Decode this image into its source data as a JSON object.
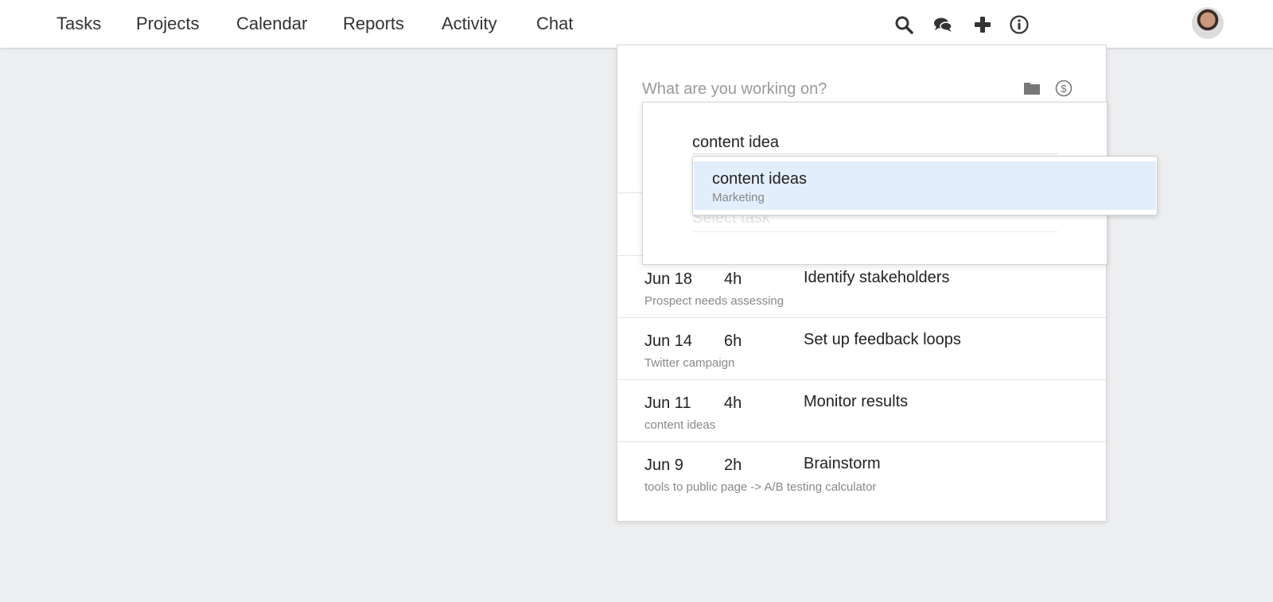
{
  "nav": {
    "items": [
      "Tasks",
      "Projects",
      "Calendar",
      "Reports",
      "Activity",
      "Chat"
    ],
    "icons": [
      "search-icon",
      "chat-icon",
      "plus-icon",
      "info-icon"
    ]
  },
  "timer": {
    "placeholder": "What are you working on?",
    "icons": [
      "folder-icon",
      "dollar-icon"
    ]
  },
  "project_picker": {
    "query": "content idea",
    "task_placeholder": "Select task",
    "option": {
      "name": "content ideas",
      "client": "Marketing"
    }
  },
  "entries": [
    {
      "date": "Jun 18",
      "hours": "4h",
      "title": "Identify stakeholders",
      "project": "Prospect needs assessing"
    },
    {
      "date": "Jun 14",
      "hours": "6h",
      "title": "Set up feedback loops",
      "project": "Twitter campaign"
    },
    {
      "date": "Jun 11",
      "hours": "4h",
      "title": "Monitor results",
      "project": "content ideas"
    },
    {
      "date": "Jun 9",
      "hours": "2h",
      "title": "Brainstorm",
      "project": "tools to public page -> A/B testing calculator"
    }
  ],
  "colors": {
    "highlight": "#e3eefc",
    "background": "#edeef0"
  }
}
